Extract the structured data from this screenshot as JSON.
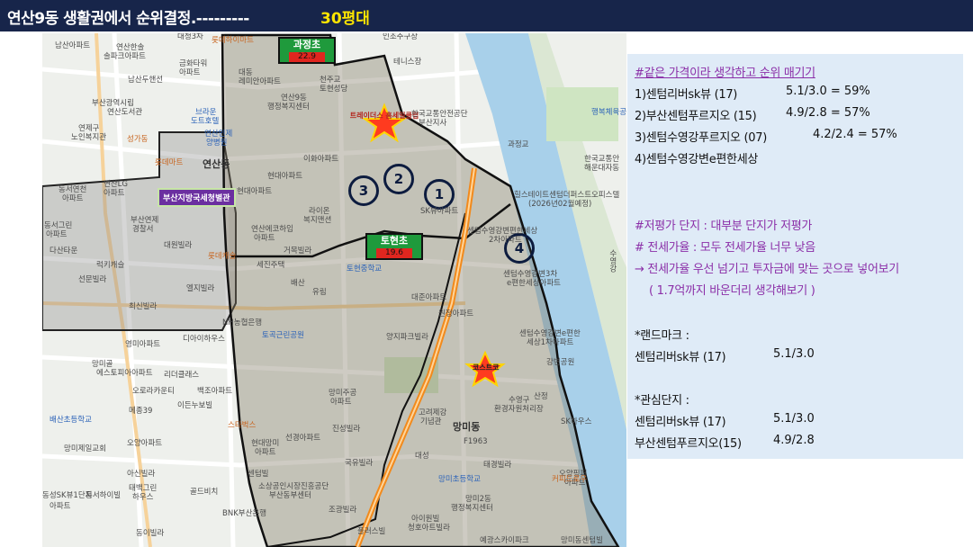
{
  "slide": {
    "title": "연산9동 생활권에서 순위결정.---------",
    "title_accent": "30평대",
    "colors": {
      "title_bg": "#17254a",
      "accent": "#ffe600",
      "panel_bg": "#dfebf7",
      "purple": "#8b2fa8"
    }
  },
  "map": {
    "schools": [
      {
        "name": "과정초",
        "score": "22.9"
      },
      {
        "name": "토현초",
        "score": "19.6"
      }
    ],
    "office": "부산지방국세청별관",
    "ranks": [
      "1",
      "2",
      "3",
      "4"
    ],
    "stars": [
      "트레이더스 홈세일클럽",
      "코스트코"
    ],
    "labels": {
      "l1": "남산아파트",
      "l2": "연산한솔",
      "l3": "솔파크아파트",
      "l4": "대청3차",
      "l5": "롯데하이마트",
      "l6": "인조주구장",
      "l7": "금화타워",
      "l8": "아파트",
      "l9": "대동",
      "l10": "레미안아파트",
      "l11": "테니스장",
      "l12": "남산두핸선",
      "l13": "부산광역시립",
      "l14": "연산도서관",
      "l15": "천주교",
      "l16": "토현성당",
      "l17": "연산9동",
      "l18": "행정복지센터",
      "l19": "브라운",
      "l20": "도트호텔",
      "l21": "연제구",
      "l22": "노인복지관",
      "l23": "성가동",
      "l24": "연산인제",
      "l25": "양병원",
      "l26": "트레이더스",
      "l27": "홈세일클럽",
      "l28": "과정교",
      "l29": "롯데마트",
      "l30": "연산동",
      "l31": "이화아파트",
      "l32": "현대아파트",
      "l33": "동서연천",
      "l34": "아파트",
      "l35": "연산LG",
      "l36": "아파트",
      "l37": "부산연제",
      "l38": "경찰서",
      "l39": "동서그린",
      "l40": "아파트",
      "l41": "라이온",
      "l42": "복지맨션",
      "l43": "SK뷰아파트",
      "l44": "롯데캐슬",
      "l45": "연산에코하임",
      "l46": "아파트",
      "l47": "거목빌라",
      "l48": "대원빌라",
      "l49": "다산타운",
      "l50": "럭키캐슬",
      "l51": "세진주택",
      "l52": "토현중학교",
      "l53": "센텀수영강변편한세상",
      "l54": "2차아파트",
      "l55": "선문빌라",
      "l56": "배산",
      "l57": "유림",
      "l58": "대준아파트",
      "l59": "최신빌라",
      "l60": "NH농협은행",
      "l61": "토곡근린공원",
      "l62": "원정아파트",
      "l63": "양지파크빌라",
      "l64": "센텀수영강변e편한",
      "l65": "세상1차아파트",
      "l66": "강변공원",
      "l67": "영미아파트",
      "l68": "디아이하우스",
      "l69": "망미골",
      "l70": "에스토피아아파트",
      "l71": "리더클래스",
      "l72": "오로라카운티",
      "l73": "백조아파트",
      "l74": "메종39",
      "l75": "이든누보빌",
      "l76": "망미주공",
      "l77": "아파트",
      "l78": "고려제강",
      "l79": "기념관",
      "l80": "망미동",
      "l81": "F1963",
      "l82": "수영구",
      "l83": "환경자원처리장",
      "l84": "배산초등학교",
      "l85": "진성빌라",
      "l86": "선경아파트",
      "l87": "오양아파트",
      "l88": "망미제일교회",
      "l89": "현대망미",
      "l90": "아파트",
      "l91": "국유빌라",
      "l92": "태경빌라",
      "l93": "아신빌라",
      "l94": "망미초등학교",
      "l95": "센텀빌",
      "l96": "소상공인시장진흥공단",
      "l97": "부산동부센터",
      "l98": "망미2동",
      "l99": "행정복지센터",
      "l100": "오양핑퍼",
      "l101": "아파트",
      "l102": "태백그린",
      "l103": "하우스",
      "l104": "골드비치",
      "l105": "조광빌라",
      "l106": "아이원빌",
      "l107": "청호아트빌라",
      "l108": "플러스빌",
      "l109": "예광스카이파크",
      "l110": "한국교통안전공단",
      "l111": "부산지사",
      "l112": "행복체육공원",
      "l113": "한국교통안",
      "l114": "해운대자동",
      "l115": "힐스테이트센텀더퍼스트오피스텔",
      "l116": "(2026년02월예정)",
      "l117": "센텀수영강변3차",
      "l118": "e편한세상아파트",
      "l119": "산정",
      "l120": "SK하우스",
      "l121": "커피드로우",
      "l122": "망미동센텀빌",
      "l123": "동성SK뷰1단지",
      "l124": "동서하이빌",
      "l125": "동이빌라",
      "l126": "BNK부산은행",
      "l127": "수영강",
      "l128": "아파트",
      "l129": "스타벅스",
      "l130": "현대아파트",
      "l131": "대성",
      "l132": "엘지빌라"
    }
  },
  "panel": {
    "heading": "#같은 가격이라 생각하고 순위 매기기",
    "ranking": [
      {
        "label": "1)센텀리버sk뷰 (17)",
        "calc": "5.1/3.0 = 59%"
      },
      {
        "label": "2)부산센텀푸르지오 (15)",
        "calc": "4.9/2.8 = 57%"
      },
      {
        "label": "3)센텀수영강푸르지오 (07)",
        "calc": "4.2/2.4 = 57%"
      },
      {
        "label": "4)센텀수영강변e편한세상",
        "calc": ""
      }
    ],
    "notes": [
      "#저평가 단지 : 대부분 단지가 저평가",
      "# 전세가율 : 모두 전세가율 너무 낮음",
      "→  전세가율 우선 넘기고 투자금에 맞는 곳으로 넣어보기",
      "( 1.7억까지  바운더리 생각해보기 )"
    ],
    "landmark": {
      "title": "*랜드마크 :",
      "name": "센텀리버sk뷰 (17)",
      "value": "5.1/3.0"
    },
    "interest": {
      "title": "*관심단지 :",
      "items": [
        {
          "name": "센텀리버sk뷰 (17)",
          "value": "5.1/3.0"
        },
        {
          "name": "부산센텀푸르지오(15)",
          "value": "4.9/2.8"
        }
      ]
    }
  }
}
